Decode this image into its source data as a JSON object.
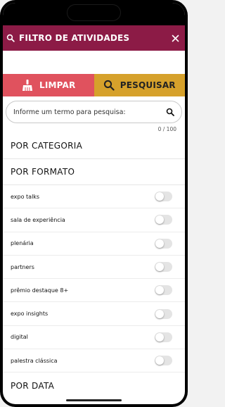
{
  "header": {
    "title": "FILTRO DE ATIVIDADES"
  },
  "actions": {
    "clear_label": "LIMPAR",
    "search_label": "PESQUISAR"
  },
  "search": {
    "placeholder": "Informe um termo para pesquisa:",
    "value": "",
    "counter": "0 / 100"
  },
  "sections": {
    "category": "POR CATEGORIA",
    "format": "POR FORMATO",
    "date": "POR DATA"
  },
  "formats": [
    {
      "label": "expo talks",
      "enabled": false
    },
    {
      "label": "sala de experiência",
      "enabled": false
    },
    {
      "label": "plenária",
      "enabled": false
    },
    {
      "label": "partners",
      "enabled": false
    },
    {
      "label": "prêmio destaque 8+",
      "enabled": false
    },
    {
      "label": "expo insights",
      "enabled": false
    },
    {
      "label": "digital",
      "enabled": false
    },
    {
      "label": "palestra clássica",
      "enabled": false
    }
  ],
  "colors": {
    "header_bg": "#8c1b46",
    "clear_bg": "#e0525e",
    "search_bg": "#d6a12b"
  }
}
